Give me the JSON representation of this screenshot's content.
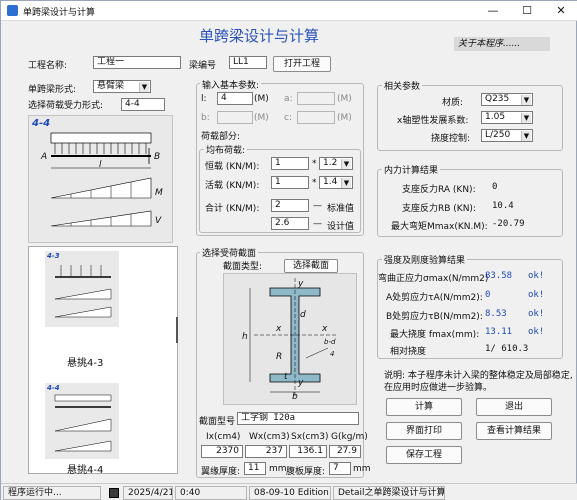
{
  "window": {
    "title": "单跨梁设计与计算",
    "minimize": "—",
    "maximize": "☐",
    "close": "✕"
  },
  "header": {
    "title": "单跨梁设计与计算",
    "about": "关于本程序......"
  },
  "project": {
    "name_label": "工程名称:",
    "name_value": "工程一",
    "beam_label": "梁编号",
    "beam_value": "LL1",
    "open_button": "打开工程"
  },
  "left": {
    "beam_form_label": "单跨梁形式:",
    "beam_form_value": "悬臂梁",
    "load_form_label": "选择荷载受力形式:",
    "load_form_value": "4-4",
    "diagram": {
      "id": "4-4",
      "A": "A",
      "B": "B",
      "l": "l",
      "M": "M",
      "V": "V"
    },
    "thumbs": [
      {
        "id": "4-3",
        "caption": "悬挑4-3"
      },
      {
        "id": "4-4",
        "caption": "悬挑4-4"
      }
    ]
  },
  "inputs": {
    "group_label": "输入基本参数:",
    "l_label": "l:",
    "l_value": "4",
    "l_unit": "(M)",
    "a_label": "a:",
    "a_unit": "(M)",
    "b_label": "b:",
    "b_unit": "(M)",
    "c_label": "c:",
    "c_unit": "(M)",
    "load_part_label": "荷载部分:",
    "uniform_label": "均布荷载:",
    "dead_label": "恒载 (KN/M):",
    "dead_value": "1",
    "dead_factor": "1.2",
    "live_label": "活载 (KN/M):",
    "live_value": "1",
    "live_factor": "1.4",
    "total_label": "合计 (KN/M):",
    "total_std": "2",
    "total_design": "2.6",
    "std_label": "标准值",
    "design_label": "设计值",
    "star": "*",
    "dash": "—"
  },
  "section": {
    "group_label": "选择受荷截面",
    "type_label": "截面类型:",
    "select_button": "选择截面",
    "diagram": {
      "y": "y",
      "x": "x",
      "h": "h",
      "d": "d",
      "R": "R",
      "t": "t",
      "b": "b",
      "bd": "b-d",
      "four": "4"
    },
    "model_label": "截面型号",
    "model_value": "工字钢 I20a",
    "col_headers": [
      "Ix(cm4)",
      "Wx(cm3)",
      "Sx(cm3)",
      "G(kg/m)"
    ],
    "col_values": [
      "2370",
      "237",
      "136.1",
      "27.9"
    ],
    "flange_label": "翼缘厚度:",
    "flange_value": "11",
    "web_label": "腹板厚度:",
    "web_value": "7",
    "mm": "mm"
  },
  "params": {
    "group_label": "相关参数",
    "material_label": "材质:",
    "material_value": "Q235",
    "gamma_label": "x轴塑性发展系数:",
    "gamma_value": "1.05",
    "defl_label": "挠度控制:",
    "defl_value": "L/250"
  },
  "forces": {
    "group_label": "内力计算结果",
    "ra_label": "支座反力RA (KN):",
    "ra_value": "0",
    "rb_label": "支座反力RB (KN):",
    "rb_value": "10.4",
    "m_label": "最大弯矩Mmax(KN.M):",
    "m_value": "-20.79"
  },
  "strength": {
    "group_label": "强度及刚度验算结果",
    "sigma_label": "弯曲正应力σmax(N/mm2)",
    "sigma_value": "83.58",
    "tauA_label": "A处剪应力τA(N/mm2):",
    "tauA_value": "0",
    "tauB_label": "B处剪应力τB(N/mm2):",
    "tauB_value": "8.53",
    "fmax_label": "最大挠度   fmax(mm):",
    "fmax_value": "13.11",
    "rel_label": "相对挠度",
    "rel_value": "1/ 610.3",
    "ok": "ok!"
  },
  "note": "说明: 本子程序未计入梁的整体稳定及局部稳定, 在应用时应做进一步验算。",
  "buttons": {
    "calc": "计算",
    "exit": "退出",
    "print": "界面打印",
    "view": "查看计算结果",
    "save": "保存工程"
  },
  "status": {
    "running": "程序运行中...",
    "date": "2025/4/21",
    "time": "0:40",
    "edition": "08-09-10 Edition",
    "detail": "Detail之单跨梁设计与计算"
  }
}
